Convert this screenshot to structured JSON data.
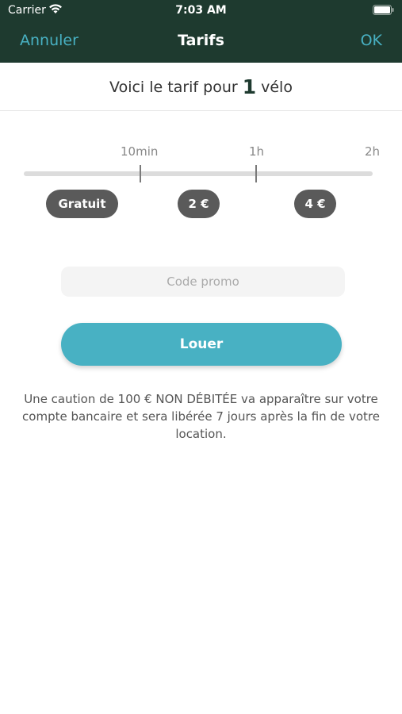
{
  "status_bar": {
    "carrier": "Carrier",
    "time": "7:03 AM"
  },
  "nav": {
    "cancel_label": "Annuler",
    "title": "Tarifs",
    "ok_label": "OK"
  },
  "subtitle": {
    "prefix": "Voici le tarif pour",
    "count": "1",
    "suffix": "vélo"
  },
  "timeline": {
    "labels": [
      "10min",
      "1h",
      "2h"
    ],
    "prices": [
      "Gratuit",
      "2 €",
      "4 €"
    ]
  },
  "promo": {
    "placeholder": "Code promo",
    "value": ""
  },
  "rent_button_label": "Louer",
  "notice": "Une caution de 100 € NON DÉBITÉE va apparaître sur votre compte bancaire et sera libérée 7 jours après la fin de votre location.",
  "colors": {
    "header_bg": "#1e3a2f",
    "accent": "#48b1c3",
    "pill_bg": "#5a5a5a"
  }
}
